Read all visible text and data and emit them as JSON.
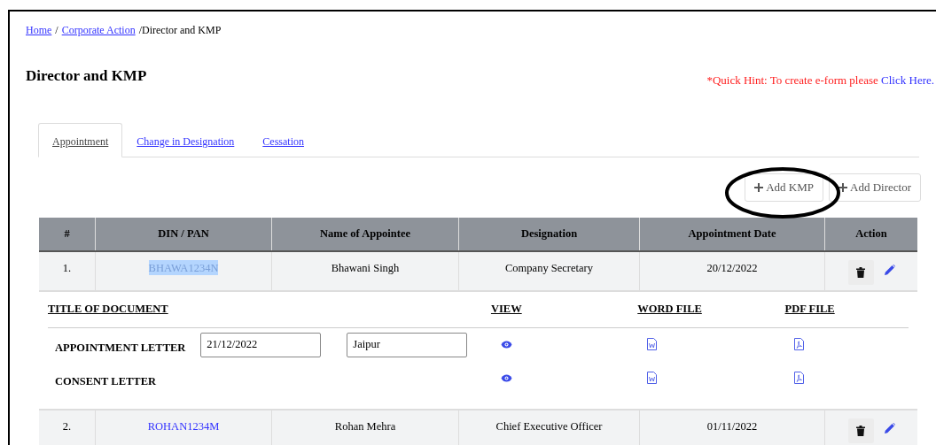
{
  "breadcrumb": [
    {
      "label": "Home",
      "kind": "link"
    },
    {
      "label": "/",
      "kind": "text"
    },
    {
      "label": "Corporate Action",
      "kind": "link"
    },
    {
      "label": "/Director and KMP",
      "kind": "text"
    }
  ],
  "title": "Director and KMP",
  "hint": {
    "text": "*Quick Hint: To create e-form please",
    "link": "Click Here."
  },
  "tabs": [
    {
      "label": "Appointment",
      "selected": true
    },
    {
      "label": "Change in Designation",
      "selected": false
    },
    {
      "label": "Cessation",
      "selected": false
    }
  ],
  "buttons": [
    {
      "label": "Add KMP"
    },
    {
      "label": "Add Director"
    }
  ],
  "table": {
    "columns": [
      "#",
      "DIN / PAN",
      "Name of Appointee",
      "Designation",
      "Appointment Date",
      "Action"
    ],
    "rows": [
      {
        "number": "1.",
        "din": "BHAWA1234N",
        "din_selected": true,
        "name": "Bhawani Singh",
        "designation": "Company Secretary",
        "date": "20/12/2022",
        "documents": {
          "headers": [
            "TITLE OF DOCUMENT",
            "VIEW",
            "WORD FILE",
            "PDF FILE"
          ],
          "items": [
            {
              "title": "APPOINTMENT LETTER",
              "date": "21/12/2022",
              "place": "Jaipur"
            },
            {
              "title": "CONSENT LETTER"
            }
          ]
        }
      },
      {
        "number": "2.",
        "din": "ROHAN1234M",
        "din_selected": false,
        "name": "Rohan Mehra",
        "designation": "Chief Executive Officer",
        "date": "01/11/2022"
      }
    ]
  }
}
